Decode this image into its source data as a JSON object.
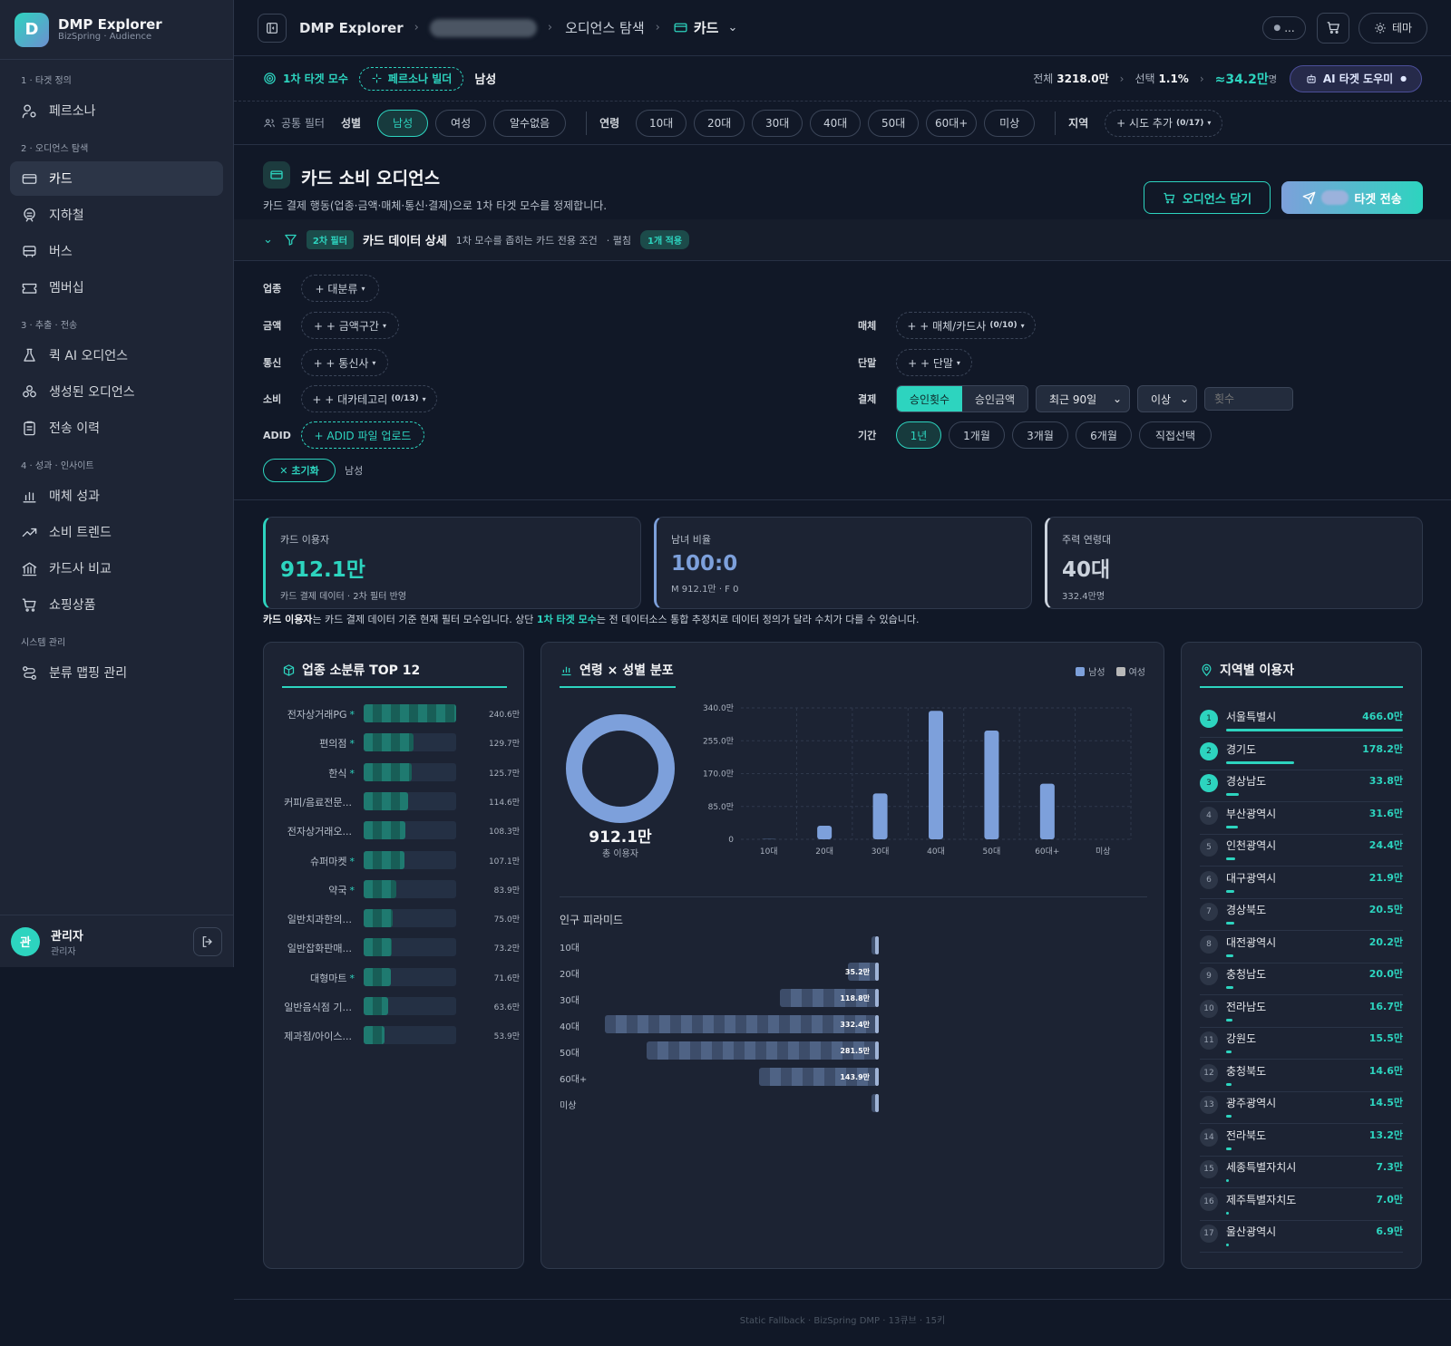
{
  "brand": {
    "logo": "D",
    "title": "DMP Explorer",
    "subtitle": "BizSpring · Audience"
  },
  "nav": {
    "sections": [
      {
        "label": "1 · 타겟 정의",
        "items": [
          {
            "label": "페르소나",
            "icon": "persona-icon"
          }
        ]
      },
      {
        "label": "2 · 오디언스 탐색",
        "items": [
          {
            "label": "카드",
            "icon": "card-icon",
            "active": true
          },
          {
            "label": "지하철",
            "icon": "subway-icon"
          },
          {
            "label": "버스",
            "icon": "bus-icon"
          },
          {
            "label": "멤버십",
            "icon": "ticket-icon"
          }
        ]
      },
      {
        "label": "3 · 추출 · 전송",
        "items": [
          {
            "label": "퀵 AI 오디언스",
            "icon": "flask-icon"
          },
          {
            "label": "생성된 오디언스",
            "icon": "circles-icon"
          },
          {
            "label": "전송 이력",
            "icon": "clipboard-icon"
          }
        ]
      },
      {
        "label": "4 · 성과 · 인사이트",
        "items": [
          {
            "label": "매체 성과",
            "icon": "bar-chart-icon"
          },
          {
            "label": "소비 트렌드",
            "icon": "trend-icon"
          },
          {
            "label": "카드사 비교",
            "icon": "bank-icon"
          },
          {
            "label": "쇼핑상품",
            "icon": "cart-icon"
          }
        ]
      },
      {
        "label": "시스템 관리",
        "items": [
          {
            "label": "분류 맵핑 관리",
            "icon": "route-icon"
          }
        ]
      }
    ]
  },
  "user": {
    "avatar": "관",
    "name": "관리자",
    "role": "관리자"
  },
  "topbar": {
    "crumb1": "DMP Explorer",
    "crumb3": "오디언스 탐색",
    "crumb4": "카드",
    "status": "...",
    "theme": "테마"
  },
  "target": {
    "primary": "1차 타겟 모수",
    "persona": "페르소나 빌더",
    "gender": "남성",
    "total_label": "전체",
    "total": "3218.0만",
    "select_label": "선택",
    "select": "1.1%",
    "approx": "≈34.2만",
    "unit": "명",
    "ai": "AI 타겟 도우미"
  },
  "common_filter": {
    "label": "공통 필터",
    "gender_label": "성별",
    "genders": [
      "남성",
      "여성",
      "알수없음"
    ],
    "age_label": "연령",
    "ages": [
      "10대",
      "20대",
      "30대",
      "40대",
      "50대",
      "60대+",
      "미상"
    ],
    "region_label": "지역",
    "region_add": "+ 시도 추가",
    "region_count": "(0/17)"
  },
  "page": {
    "title": "카드 소비 오디언스",
    "desc": "카드 결제 행동(업종·금액·매체·통신·결제)으로 1차 타겟 모수를 정제합니다.",
    "btn_cart": "오디언스 담기",
    "btn_send": "타겟 전송"
  },
  "filter2": {
    "badge": "2차 필터",
    "title": "카드 데이터 상세",
    "desc": "1차 모수를 좁히는 카드 전용 조건",
    "expand": "· 펼침",
    "applied": "1개 적용",
    "industry_label": "업종",
    "industry_btn": "+ 대분류",
    "amount_label": "금액",
    "amount_btn": "+ + 금액구간",
    "telecom_label": "통신",
    "telecom_btn": "+ + 통신사",
    "spend_label": "소비",
    "spend_btn": "+ + 대카테고리",
    "spend_count": "(0/13)",
    "adid_label": "ADID",
    "adid_btn": "+ ADID 파일 업로드",
    "media_label": "매체",
    "media_btn": "+ + 매체/카드사",
    "media_count": "(0/10)",
    "device_label": "단말",
    "device_btn": "+ + 단말",
    "pay_label": "결제",
    "pay_opt1": "승인횟수",
    "pay_opt2": "승인금액",
    "pay_period": "최근 90일",
    "pay_cmp": "이상",
    "pay_placeholder": "횟수",
    "term_label": "기간",
    "terms": [
      "1년",
      "1개월",
      "3개월",
      "6개월",
      "직접선택"
    ],
    "reset": "✕ 초기화",
    "applied_tag": "남성"
  },
  "stats": [
    {
      "title": "카드 이용자",
      "value": "912.1만",
      "sub": "카드 결제 데이터 · 2차 필터 반영",
      "color": "#2dd4bf"
    },
    {
      "title": "남녀 비율",
      "value": "100:0",
      "sub": "M 912.1만 · F 0",
      "color": "#7da0db"
    },
    {
      "title": "주력 연령대",
      "value": "40대",
      "sub": "332.4만명",
      "color": "#cbd2dc"
    }
  ],
  "notice": {
    "b1": "카드 이용자",
    "t1": "는 카드 결제 데이터 기준 현재 필터 모수입니다. 상단 ",
    "b2": "1차 타겟 모수",
    "t2": "는 전 데이터소스 통합 추정치로 데이터 정의가 달라 수치가 다를 수 있습니다."
  },
  "industry": {
    "title": "업종 소분류 TOP 12",
    "rows": [
      {
        "label": "전자상거래PG",
        "star": "*",
        "value": "240.6만",
        "v": 240.6
      },
      {
        "label": "편의점",
        "star": "*",
        "value": "129.7만",
        "v": 129.7
      },
      {
        "label": "한식",
        "star": "*",
        "value": "125.7만",
        "v": 125.7
      },
      {
        "label": "커피/음료전문...",
        "star": "",
        "value": "114.6만",
        "v": 114.6
      },
      {
        "label": "전자상거래오...",
        "star": "",
        "value": "108.3만",
        "v": 108.3
      },
      {
        "label": "슈퍼마켓",
        "star": "*",
        "value": "107.1만",
        "v": 107.1
      },
      {
        "label": "약국",
        "star": "*",
        "value": "83.9만",
        "v": 83.9
      },
      {
        "label": "일반치과한의...",
        "star": "",
        "value": "75.0만",
        "v": 75.0
      },
      {
        "label": "일반잡화판매...",
        "star": "",
        "value": "73.2만",
        "v": 73.2
      },
      {
        "label": "대형마트",
        "star": "*",
        "value": "71.6만",
        "v": 71.6
      },
      {
        "label": "일반음식점 기...",
        "star": "",
        "value": "63.6만",
        "v": 63.6
      },
      {
        "label": "제과점/아이스...",
        "star": "",
        "value": "53.9만",
        "v": 53.9
      }
    ]
  },
  "age_panel": {
    "title": "연령 × 성별 분포",
    "legend_m": "남성",
    "legend_f": "여성",
    "donut_value": "912.1만",
    "donut_label": "총 이용자",
    "pyramid_title": "인구 피라미드"
  },
  "chart_data": {
    "type": "bar",
    "categories": [
      "10대",
      "20대",
      "30대",
      "40대",
      "50대",
      "60대+",
      "미상"
    ],
    "series": [
      {
        "name": "남성",
        "values": [
          0.5,
          35.2,
          118.8,
          332.4,
          281.5,
          143.9,
          0
        ]
      },
      {
        "name": "여성",
        "values": [
          0,
          0,
          0,
          0,
          0,
          0,
          0
        ]
      }
    ],
    "yticks": [
      "0",
      "85.0만",
      "170.0만",
      "255.0만",
      "340.0만"
    ],
    "ylim": [
      0,
      340
    ],
    "colors": {
      "male": "#7da0db",
      "female": "#b8b8b8"
    }
  },
  "pyramid": [
    {
      "label": "10대",
      "value": "",
      "v": 0.5
    },
    {
      "label": "20대",
      "value": "35.2만",
      "v": 35.2
    },
    {
      "label": "30대",
      "value": "118.8만",
      "v": 118.8
    },
    {
      "label": "40대",
      "value": "332.4만",
      "v": 332.4
    },
    {
      "label": "50대",
      "value": "281.5만",
      "v": 281.5
    },
    {
      "label": "60대+",
      "value": "143.9만",
      "v": 143.9
    },
    {
      "label": "미상",
      "value": "",
      "v": 0
    }
  ],
  "region": {
    "title": "지역별 이용자",
    "rows": [
      {
        "no": "1",
        "name": "서울특별시",
        "value": "466.0만",
        "v": 466.0
      },
      {
        "no": "2",
        "name": "경기도",
        "value": "178.2만",
        "v": 178.2
      },
      {
        "no": "3",
        "name": "경상남도",
        "value": "33.8만",
        "v": 33.8
      },
      {
        "no": "4",
        "name": "부산광역시",
        "value": "31.6만",
        "v": 31.6
      },
      {
        "no": "5",
        "name": "인천광역시",
        "value": "24.4만",
        "v": 24.4
      },
      {
        "no": "6",
        "name": "대구광역시",
        "value": "21.9만",
        "v": 21.9
      },
      {
        "no": "7",
        "name": "경상북도",
        "value": "20.5만",
        "v": 20.5
      },
      {
        "no": "8",
        "name": "대전광역시",
        "value": "20.2만",
        "v": 20.2
      },
      {
        "no": "9",
        "name": "충청남도",
        "value": "20.0만",
        "v": 20.0
      },
      {
        "no": "10",
        "name": "전라남도",
        "value": "16.7만",
        "v": 16.7
      },
      {
        "no": "11",
        "name": "강원도",
        "value": "15.5만",
        "v": 15.5
      },
      {
        "no": "12",
        "name": "충청북도",
        "value": "14.6만",
        "v": 14.6
      },
      {
        "no": "13",
        "name": "광주광역시",
        "value": "14.5만",
        "v": 14.5
      },
      {
        "no": "14",
        "name": "전라북도",
        "value": "13.2만",
        "v": 13.2
      },
      {
        "no": "15",
        "name": "세종특별자치시",
        "value": "7.3만",
        "v": 7.3
      },
      {
        "no": "16",
        "name": "제주특별자치도",
        "value": "7.0만",
        "v": 7.0
      },
      {
        "no": "17",
        "name": "울산광역시",
        "value": "6.9만",
        "v": 6.9
      }
    ]
  },
  "footer": "Static Fallback · BizSpring DMP · 13큐브 · 15키"
}
